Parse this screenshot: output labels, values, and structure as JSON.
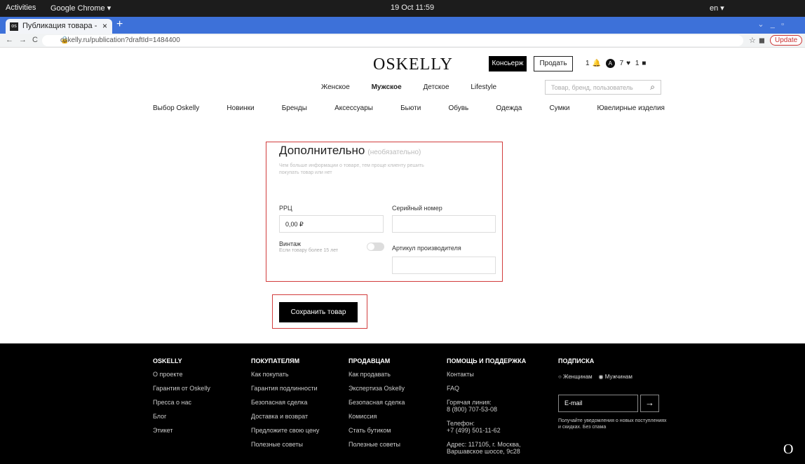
{
  "os": {
    "activities": "Activities",
    "app": "Google Chrome ▾",
    "clock": "19 Oct 11:59",
    "lang": "en ▾"
  },
  "tab": {
    "favicon": "os",
    "title": "Публикация товара - Ин",
    "close": "×",
    "new": "+"
  },
  "address": {
    "url": "oskelly.ru/publication?draftId=1484400",
    "update": "Update"
  },
  "header": {
    "logo": "OSKELLY",
    "concierge": "Консьерж",
    "sell": "Продать",
    "notifications": "1",
    "messages": "7",
    "cart": "1",
    "gender": [
      "Женское",
      "Мужское",
      "Детское",
      "Lifestyle"
    ],
    "search_placeholder": "Товар, бренд, пользователь"
  },
  "categories": [
    "Выбор Oskelly",
    "Новинки",
    "Бренды",
    "Аксессуары",
    "Бьюти",
    "Обувь",
    "Одежда",
    "Сумки",
    "Ювелирные изделия"
  ],
  "form": {
    "title": "Дополнительно",
    "optional": "(необязательно)",
    "subtitle": "Чем больше информации о товаре, тем проще клиенту решить покупать товар или нет",
    "rrp_label": "РРЦ",
    "rrp_value": "0,00 ₽",
    "serial_label": "Серийный номер",
    "vintage_label": "Винтаж",
    "vintage_hint": "Если товару более 15 лет",
    "article_label": "Артикул производителя",
    "save": "Сохранить товар"
  },
  "footer": {
    "oskelly": {
      "title": "OSKELLY",
      "items": [
        "О проекте",
        "Гарантия от Oskelly",
        "Пресса о нас",
        "Блог",
        "Этикет"
      ]
    },
    "buyers": {
      "title": "ПОКУПАТЕЛЯМ",
      "items": [
        "Как покупать",
        "Гарантия подлинности",
        "Безопасная сделка",
        "Доставка и возврат",
        "Предложите свою цену",
        "Полезные советы"
      ]
    },
    "sellers": {
      "title": "ПРОДАВЦАМ",
      "items": [
        "Как продавать",
        "Экспертиза Oskelly",
        "Безопасная сделка",
        "Комиссия",
        "Стать бутиком",
        "Полезные советы"
      ]
    },
    "help": {
      "title": "ПОМОЩЬ И ПОДДЕРЖКА",
      "contacts": "Контакты",
      "faq": "FAQ",
      "hotline_label": "Горячая линия:",
      "hotline": "8 (800) 707-53-08",
      "phone_label": "Телефон:",
      "phone": "+7 (499) 501-11-62",
      "address": "Адрес: 117105, г. Москва, Варшавское шоссе, 9с28"
    },
    "subscribe": {
      "title": "ПОДПИСКА",
      "women": "Женщинам",
      "men": "Мужчинам",
      "email_placeholder": "E-mail",
      "arrow": "→",
      "note": "Получайте уведомления о новых поступлениях и скидках. Без спама"
    },
    "mark": "O"
  }
}
